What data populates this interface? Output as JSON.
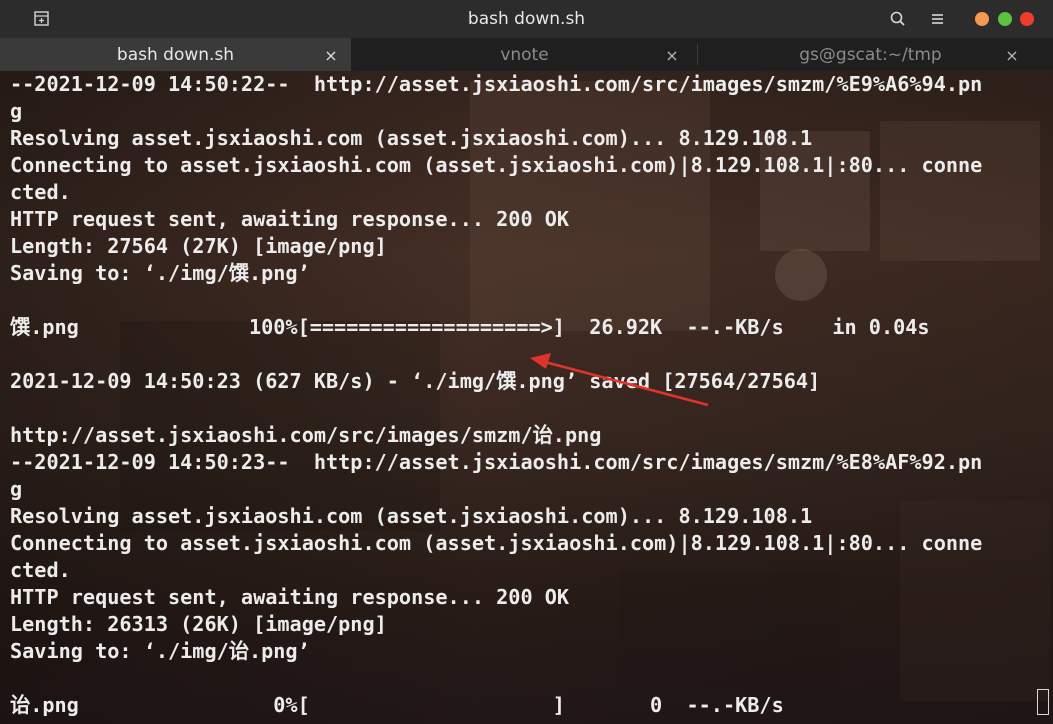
{
  "window": {
    "title": "bash down.sh",
    "controls": {
      "minimize_color": "#f39a51",
      "maximize_color": "#5fbf3f",
      "close_color": "#ee3d2f"
    }
  },
  "header": {
    "new_tab_icon": "new-tab-icon",
    "search_icon": "search-icon",
    "menu_icon": "hamburger-menu-icon"
  },
  "tabs": [
    {
      "label": "bash down.sh",
      "active": true,
      "close": "×"
    },
    {
      "label": "vnote",
      "active": false,
      "close": "×"
    },
    {
      "label": "gs@gscat:~/tmp",
      "active": false,
      "close": "×"
    }
  ],
  "terminal": {
    "text_color": "#ececec",
    "annotation_color": "#e0332b",
    "lines": [
      "--2021-12-09 14:50:22--  http://asset.jsxiaoshi.com/src/images/smzm/%E9%A6%94.pn",
      "g",
      "Resolving asset.jsxiaoshi.com (asset.jsxiaoshi.com)... 8.129.108.1",
      "Connecting to asset.jsxiaoshi.com (asset.jsxiaoshi.com)|8.129.108.1|:80... conne",
      "cted.",
      "HTTP request sent, awaiting response... 200 OK",
      "Length: 27564 (27K) [image/png]",
      "Saving to: ‘./img/馔.png’",
      "",
      "馔.png              100%[===================>]  26.92K  --.-KB/s    in 0.04s",
      "",
      "2021-12-09 14:50:23 (627 KB/s) - ‘./img/馔.png’ saved [27564/27564]",
      "",
      "http://asset.jsxiaoshi.com/src/images/smzm/诒.png",
      "--2021-12-09 14:50:23--  http://asset.jsxiaoshi.com/src/images/smzm/%E8%AF%92.pn",
      "g",
      "Resolving asset.jsxiaoshi.com (asset.jsxiaoshi.com)... 8.129.108.1",
      "Connecting to asset.jsxiaoshi.com (asset.jsxiaoshi.com)|8.129.108.1|:80... conne",
      "cted.",
      "HTTP request sent, awaiting response... 200 OK",
      "Length: 26313 (26K) [image/png]",
      "Saving to: ‘./img/诒.png’",
      "",
      "诒.png                0%[                    ]       0  --.-KB/s"
    ]
  }
}
